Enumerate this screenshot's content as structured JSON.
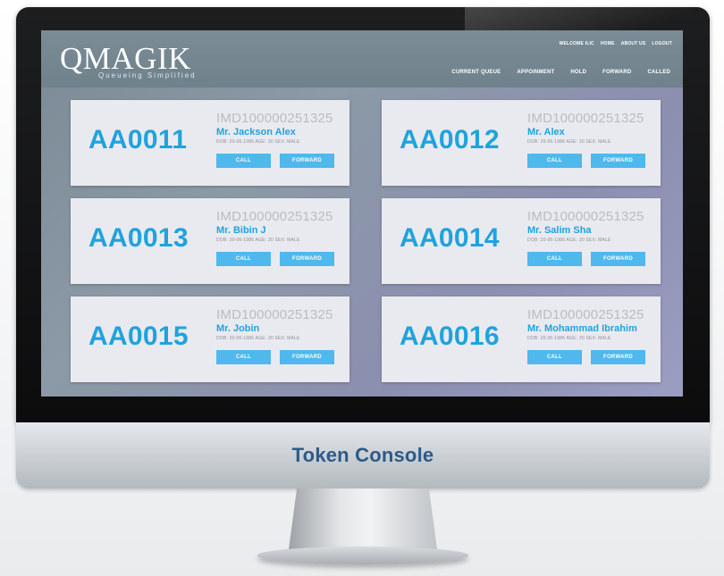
{
  "app": {
    "logo": "QMAGIK",
    "tagline": "Queueing Simplified"
  },
  "top_nav": [
    "WELCOME ILIC",
    "HOME",
    "ABOUT US",
    "LOGOUT"
  ],
  "main_nav": [
    "CURRENT QUEUE",
    "APPOINMENT",
    "HOLD",
    "FORWARD",
    "CALLED"
  ],
  "labels": {
    "call": "CALL",
    "forward": "FORWARD"
  },
  "tokens": [
    {
      "token": "AA0011",
      "id": "IMD100000251325",
      "name": "Mr. Jackson Alex",
      "meta": "DOB: 20-06-1986   AGE: 30   SEX: MALE"
    },
    {
      "token": "AA0012",
      "id": "IMD100000251325",
      "name": "Mr.  Alex",
      "meta": "DOB: 20-06-1986   AGE: 30   SEX: MALE"
    },
    {
      "token": "AA0013",
      "id": "IMD100000251325",
      "name": "Mr. Bibin J",
      "meta": "DOB: 20-06-1986   AGE: 30   SEX: MALE"
    },
    {
      "token": "AA0014",
      "id": "IMD100000251325",
      "name": "Mr. Salim Sha",
      "meta": "DOB: 20-06-1986   AGE: 30   SEX: MALE"
    },
    {
      "token": "AA0015",
      "id": "IMD100000251325",
      "name": "Mr. Jobin",
      "meta": "DOB: 20-06-1986   AGE: 30   SEX: MALE"
    },
    {
      "token": "AA0016",
      "id": "IMD100000251325",
      "name": "Mr. Mohammad Ibrahim",
      "meta": "DOB: 20-06-1986   AGE: 30   SEX: MALE"
    }
  ],
  "monitor_caption": "Token Console",
  "colors": {
    "accent": "#1fa3dc",
    "button": "#4fb8ec",
    "caption": "#2d5a88",
    "card": "#e9eaf0"
  }
}
